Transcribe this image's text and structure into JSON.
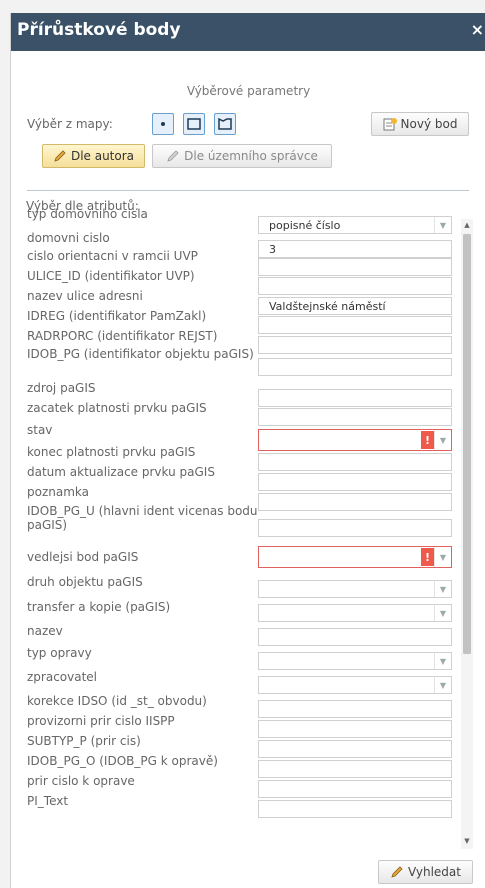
{
  "window": {
    "title": "Přírůstkové body",
    "close": "×"
  },
  "subtitle": "Výběrové parametry",
  "map_select": {
    "label": "Výběr z mapy:"
  },
  "buttons": {
    "new_point": "Nový bod",
    "by_author": "Dle autora",
    "by_admin": "Dle územního správce",
    "search": "Vyhledat"
  },
  "attributes": {
    "title": "Výběr dle atributů:",
    "rows": [
      {
        "label": "typ domovniho cisla",
        "value": "popisné číslo"
      },
      {
        "label": "domovni cislo",
        "value": "3"
      },
      {
        "label": "cislo orientacni v ramcii UVP",
        "value": ""
      },
      {
        "label": "ULICE_ID (identifikator UVP)",
        "value": ""
      },
      {
        "label": "nazev ulice adresni",
        "value": "Valdštejnské náměstí"
      },
      {
        "label": "IDREG (identifikator PamZakl)",
        "value": ""
      },
      {
        "label": "RADRPORC (identifikator REJST)",
        "value": ""
      },
      {
        "label": "IDOB_PG (identifikator objektu paGIS)",
        "value": ""
      },
      {
        "label": "zdroj paGIS",
        "value": ""
      },
      {
        "label": "zacatek platnosti prvku paGIS",
        "value": ""
      },
      {
        "label": "stav",
        "value": ""
      },
      {
        "label": "konec platnosti prvku paGIS",
        "value": ""
      },
      {
        "label": "datum aktualizace prvku paGIS",
        "value": ""
      },
      {
        "label": "poznamka",
        "value": ""
      },
      {
        "label": "IDOB_PG_U (hlavni ident vicenas bodu paGIS)",
        "value": ""
      },
      {
        "label": "vedlejsi bod paGIS",
        "value": ""
      },
      {
        "label": "druh objektu paGIS",
        "value": ""
      },
      {
        "label": "transfer a kopie (paGIS)",
        "value": ""
      },
      {
        "label": "nazev",
        "value": ""
      },
      {
        "label": "typ opravy",
        "value": ""
      },
      {
        "label": "zpracovatel",
        "value": ""
      },
      {
        "label": "korekce IDSO (id _st_ obvodu)",
        "value": ""
      },
      {
        "label": "provizorni prir cislo IISPP",
        "value": ""
      },
      {
        "label": "SUBTYP_P (prir cis)",
        "value": ""
      },
      {
        "label": "IDOB_PG_O (IDOB_PG k opravě)",
        "value": ""
      },
      {
        "label": "prir cislo k oprave",
        "value": ""
      },
      {
        "label": "PI_Text",
        "value": ""
      }
    ]
  },
  "colors": {
    "titlebar": "#3a5168",
    "error": "#f05a4b",
    "accent": "#f5df9a"
  }
}
